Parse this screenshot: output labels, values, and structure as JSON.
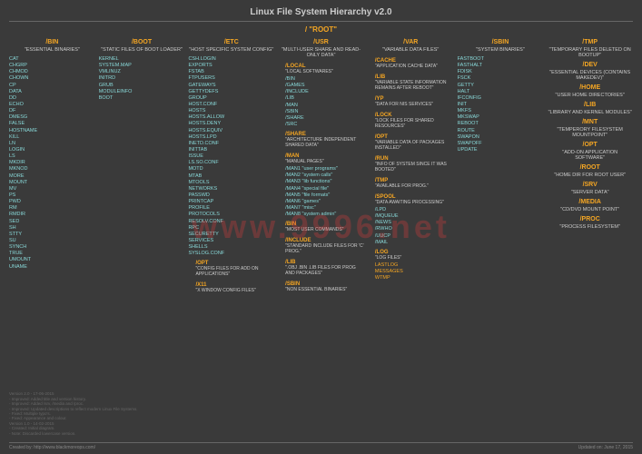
{
  "title": "Linux File System Hierarchy v2.0",
  "root": "/ \"ROOT\"",
  "watermark": "www.9996.net",
  "cols": [
    {
      "dir": "/BIN",
      "desc": "\"ESSENTIAL BINARIES\"",
      "items": [
        "CAT",
        "CHGRP",
        "CHMOD",
        "CHOWN",
        "CP",
        "DATA",
        "DD",
        "ECHO",
        "DF",
        "DMESG",
        "FALSE",
        "HOSTNAME",
        "KILL",
        "LN",
        "LOGIN",
        "LS",
        "MKDIR",
        "MKNOD",
        "MORE",
        "MOUNT",
        "MV",
        "PS",
        "PWD",
        "RM",
        "RMDIR",
        "SED",
        "SH",
        "STTY",
        "SU",
        "SYNCH",
        "TRUE",
        "UMOUNT",
        "UNAME"
      ]
    },
    {
      "dir": "/BOOT",
      "desc": "\"STATIC FILES OF BOOT LOADER\"",
      "items": [
        "KERNEL",
        "SYSTEM.MAP",
        "VMLINUZ",
        "INITRD",
        "GRUB",
        "MODULEINFO",
        "BOOT"
      ]
    },
    {
      "dir": "/ETC",
      "desc": "\"HOST SPECIFIC SYSTEM CONFIG\"",
      "items": [
        "CSH.LOGIN",
        "EXPORTS",
        "FSTAB",
        "FTPUSERS",
        "GATEWAYS",
        "GETTYDEFS",
        "GROUP",
        "HOST.CONF",
        "HOSTS",
        "HOSTS.ALLOW",
        "HOSTS.DENY",
        "HOSTS.EQUIV",
        "HOSTS.LPD",
        "INETD.CONF",
        "INITTAB",
        "ISSUE",
        "LS.SO.CONF",
        "MOTD",
        "MTAB",
        "MTOOLS",
        "NETWORKS",
        "PASSWD",
        "PRINTCAP",
        "PROFILE",
        "PROTOCOLS",
        "RESOLV.CONF",
        "RPC",
        "SECURETTY",
        "SERVICES",
        "SHELLS",
        "SYSLOG.CONF"
      ],
      "subs": [
        {
          "dir": "/OPT",
          "desc": "\"CONFIG FILES FOR ADD ON APPLICATIONS\""
        },
        {
          "dir": "/X11",
          "desc": "\"X WINDOW CONFIG FILES\""
        }
      ]
    },
    {
      "dir": "/USR",
      "desc": "\"MULTI-USER SHARE AND READ-ONLY DATA\"",
      "subs": [
        {
          "dir": "/LOCAL",
          "desc": "\"LOCAL SOFTWARES\"",
          "items": [
            "/BIN",
            "/GAMES",
            "/INCLUDE",
            "/LIB",
            "/MAN",
            "/SBIN",
            "/SHARE",
            "/SRC"
          ]
        },
        {
          "dir": "/SHARE",
          "desc": "\"ARCHITECTURE INDEPENDENT SHARED DATA\""
        },
        {
          "dir": "/MAN",
          "desc": "\"MANUAL PAGES\"",
          "items": [
            "/MAN1 \"user programs\"",
            "/MAN2 \"system calls\"",
            "/MAN3 \"lib functions\"",
            "/MAN4 \"special file\"",
            "/MAN5 \"file formats\"",
            "/MAN6 \"games\"",
            "/MAN7 \"misc\"",
            "/MAN8 \"system admin\""
          ]
        },
        {
          "dir": "/BIN",
          "desc": "\"MOST USER COMMANDS\""
        },
        {
          "dir": "/INCLUDE",
          "desc": "\"STANDARD INCLUDE FILES FOR 'C' PROG.\""
        },
        {
          "dir": "/LIB",
          "desc": "\".OBJ .BIN .LIB FILES FOR PROG AND PACKAGES\""
        },
        {
          "dir": "/SBIN",
          "desc": "\"NON ESSENTIAL BINARIES\""
        }
      ]
    },
    {
      "dir": "/VAR",
      "desc": "\"VARIABLE DATA FILES\"",
      "subs": [
        {
          "dir": "/CACHE",
          "desc": "\"APPLICATION CACHE DATA\""
        },
        {
          "dir": "/LIB",
          "desc": "\"VARIABLE STATE INFORMATION REMAINS AFTER REBOOT\""
        },
        {
          "dir": "/YP",
          "desc": "\"DATA FOR NIS SERVICES\""
        },
        {
          "dir": "/LOCK",
          "desc": "\"LOCK FILES FOR SHARED RESOURCES\""
        },
        {
          "dir": "/OPT",
          "desc": "\"VARIABLE DATA OF PACKAGES INSTALLED\""
        },
        {
          "dir": "/RUN",
          "desc": "\"INFO OF SYSTEM SINCE IT WAS BOOTED\""
        },
        {
          "dir": "/TMP",
          "desc": "\"AVAILABLE FOR PROG.\""
        },
        {
          "dir": "/SPOOL",
          "desc": "\"DATA AWAITING PROCESSING\"",
          "items": [
            "/LPD",
            "/MQUEUE",
            "/NEWS",
            "/RWHO",
            "/UUCP",
            "/MAIL"
          ]
        },
        {
          "dir": "/LOG",
          "desc": "\"LOG FILES\"",
          "logitems": [
            "LASTLOG",
            "MESSAGES",
            "WTMP"
          ]
        }
      ]
    },
    {
      "dir": "/SBIN",
      "desc": "\"SYSTEM BINARIES\"",
      "items": [
        "FASTBOOT",
        "FASTHALT",
        "FDISK",
        "FSCK",
        "GETTY",
        "HALT",
        "IFCONFIG",
        "INIT",
        "MKFS",
        "MKSWAP",
        "REBOOT",
        "ROUTE",
        "SWAPON",
        "SWAPOFF",
        "UPDATE"
      ]
    },
    {
      "rows": [
        {
          "dir": "/TMP",
          "desc": "\"TEMPORARY FILES DELETED ON BOOTUP\""
        },
        {
          "dir": "/DEV",
          "desc": "\"ESSENTIAL DEVICES (CONTAINS MAKEDEV)\""
        },
        {
          "dir": "/HOME",
          "desc": "\"USER HOME DIRECTORIES\""
        },
        {
          "dir": "/LIB",
          "desc": "\"LIBRARY AND KERNEL MODULES\""
        },
        {
          "dir": "/MNT",
          "desc": "\"TEMPERORY FILESYSTEM MOUNTPOINT\""
        },
        {
          "dir": "/OPT",
          "desc": "\"ADD-ON APPLICATION SOFTWARE\""
        },
        {
          "dir": "/ROOT",
          "desc": "\"HOME DIR FOR ROOT USER\""
        },
        {
          "dir": "/SRV",
          "desc": "\"SERVER DATA\""
        },
        {
          "dir": "/MEDIA",
          "desc": "\"CD/DVD MOUNT POINT\""
        },
        {
          "dir": "/PROC",
          "desc": "\"PROCESS FILESYSTEM\""
        }
      ]
    }
  ],
  "version": [
    "Version 2.0 - 17-06-2015",
    "- Improved: Added title and version history.",
    "- Improved: Added /srv, /media and /proc.",
    "- Improved: Updated descriptions to reflect modern Linux File Systems.",
    "- Fixed: Multiple typo's.",
    "- Fixed: Appearance and colour.",
    "Version 1.0 - 14-02-2015",
    "- Created: Initial diagram.",
    "- Note: Discarded lowercase version."
  ],
  "footer": {
    "left": "Created by: http://www.blackmoreops.com/",
    "right": "Updated on: June 17, 2015"
  }
}
